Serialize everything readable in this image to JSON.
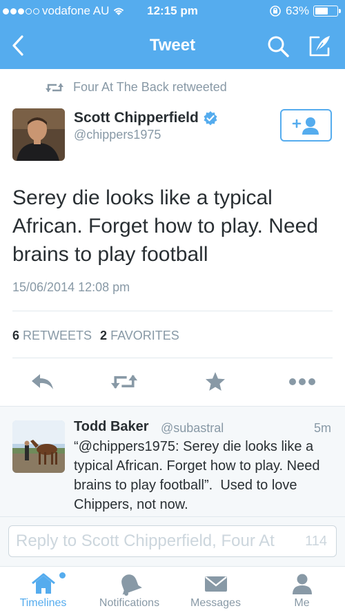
{
  "status_bar": {
    "carrier": "vodafone AU",
    "time": "12:15 pm",
    "battery": "63%",
    "battery_level": 0.63,
    "signal_bars_filled": 3,
    "signal_bars_total": 5
  },
  "nav": {
    "title": "Tweet"
  },
  "retweet_context": "Four At The Back retweeted",
  "tweet": {
    "author_name": "Scott Chipperfield",
    "author_handle": "@chippers1975",
    "verified": true,
    "text": "Serey die looks like a typical African. Forget how to play. Need brains to play football",
    "date": "15/06/2014 12:08 pm",
    "retweets_count": "6",
    "retweets_label": "RETWEETS",
    "favorites_count": "2",
    "favorites_label": "FAVORITES"
  },
  "reply": {
    "author_name": "Todd Baker",
    "author_handle": "@subastral",
    "time": "5m",
    "text": "“@chippers1975: Serey die looks like a typical African. Forget how to play. Need brains to play football”.  Used to love Chippers, not now."
  },
  "compose": {
    "placeholder": "Reply to Scott Chipperfield, Four At",
    "char_count": "114"
  },
  "tabs": [
    {
      "label": "Timelines",
      "icon": "home-icon",
      "active": true
    },
    {
      "label": "Notifications",
      "icon": "bell-icon",
      "active": false
    },
    {
      "label": "Messages",
      "icon": "envelope-icon",
      "active": false
    },
    {
      "label": "Me",
      "icon": "person-icon",
      "active": false
    }
  ],
  "colors": {
    "accent": "#55acee",
    "muted": "#8899a6",
    "text": "#292f33",
    "divider": "#e1e8ed"
  }
}
